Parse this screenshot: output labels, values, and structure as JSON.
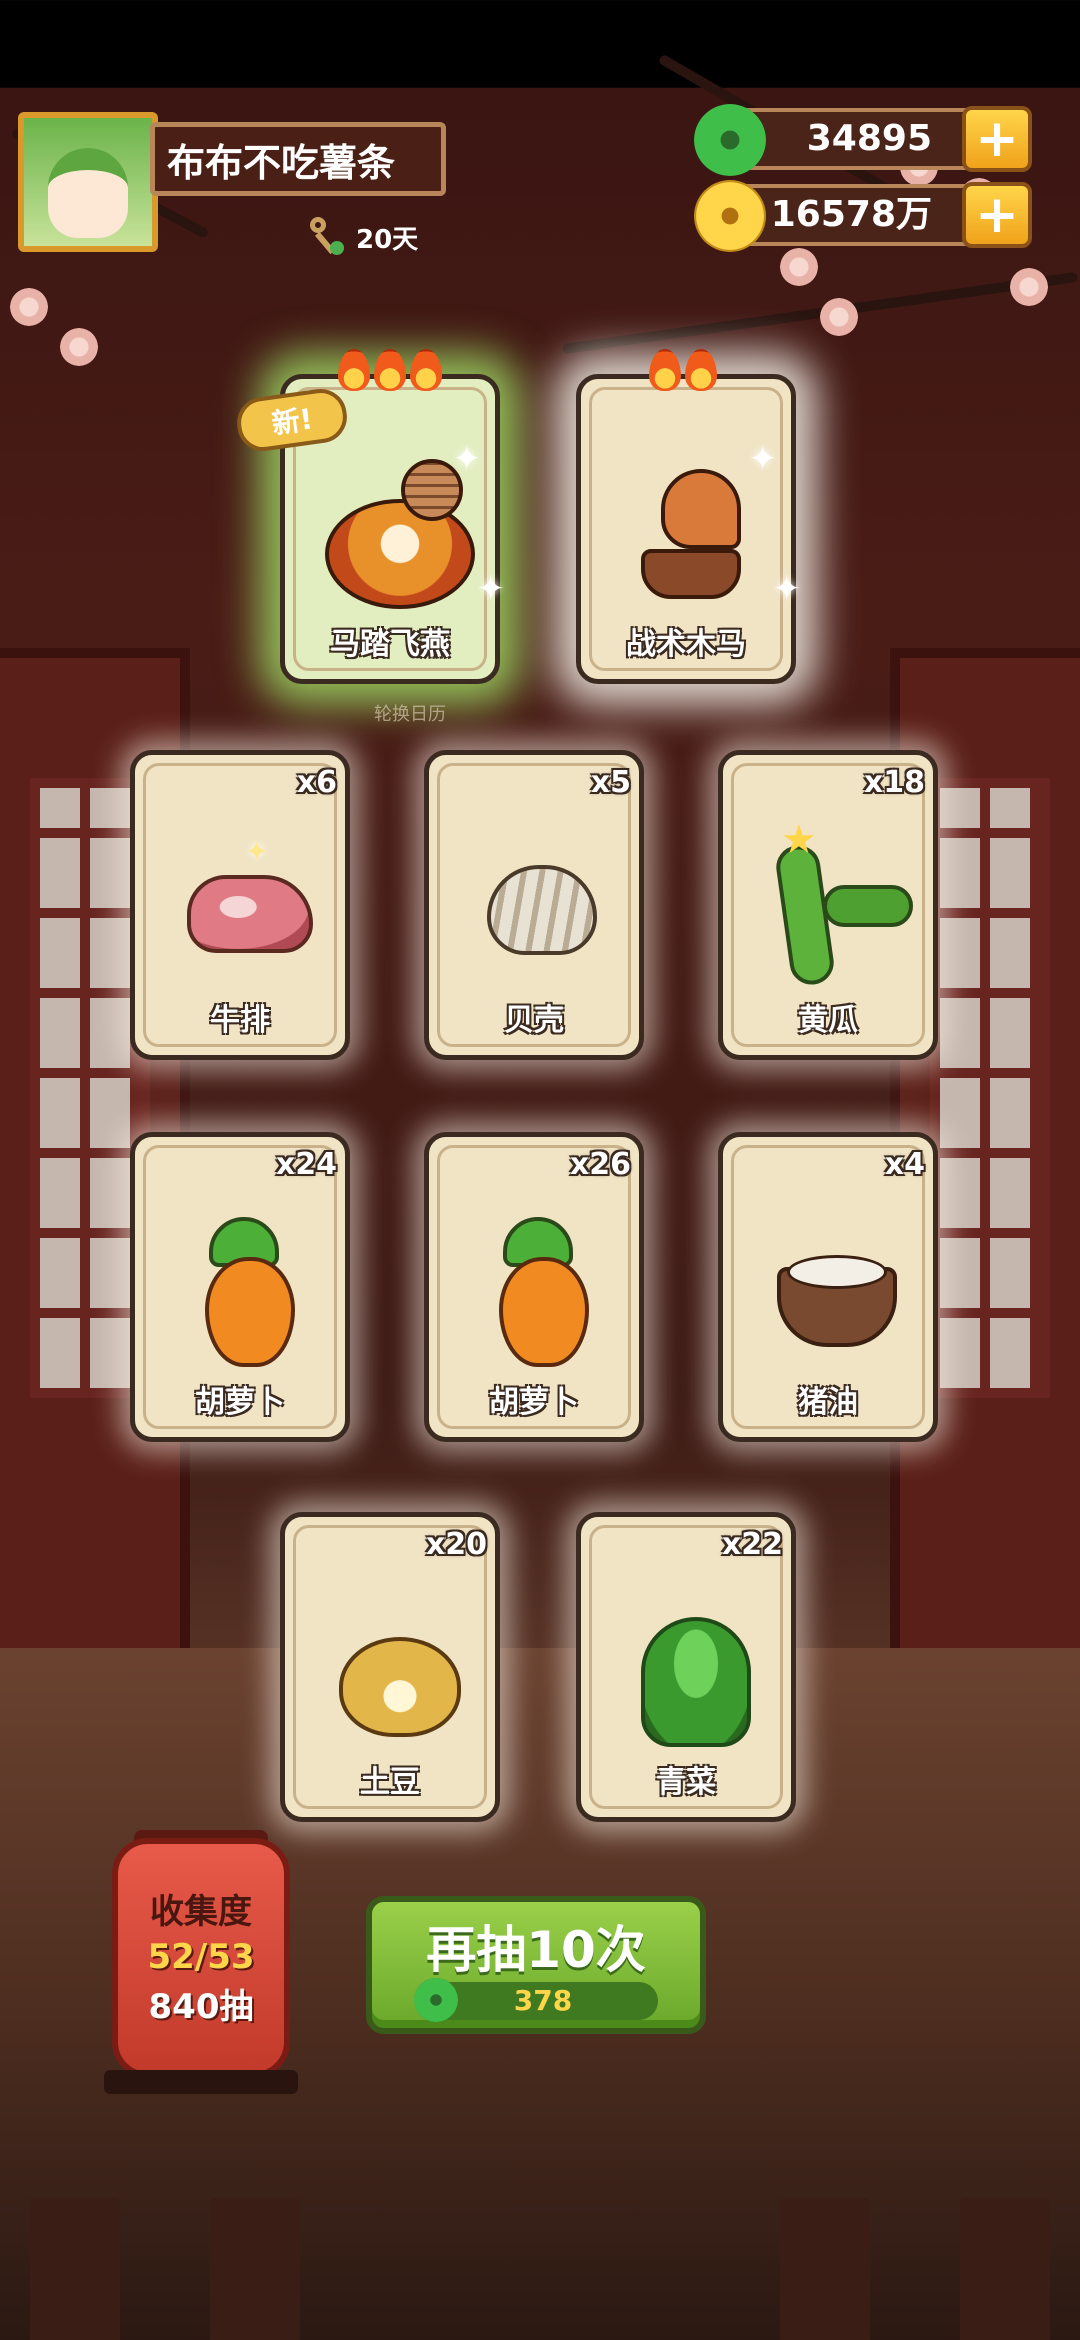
{
  "player": {
    "name": "布布不吃薯条",
    "streak": "20天"
  },
  "currencies": {
    "jade": "34895",
    "gold": "16578万"
  },
  "featured_cards": [
    {
      "label": "马踏飞燕",
      "flames": 3,
      "badge": "新!",
      "glow": "#aaf06e"
    },
    {
      "label": "战术木马",
      "flames": 2,
      "glow": "#fffff5"
    }
  ],
  "overlay_text": "轮换日历",
  "cards": [
    {
      "label": "牛排",
      "count": "x6"
    },
    {
      "label": "贝壳",
      "count": "x5"
    },
    {
      "label": "黄瓜",
      "count": "x18"
    },
    {
      "label": "胡萝卜",
      "count": "x24"
    },
    {
      "label": "胡萝卜",
      "count": "x26"
    },
    {
      "label": "猪油",
      "count": "x4"
    },
    {
      "label": "土豆",
      "count": "x20"
    },
    {
      "label": "青菜",
      "count": "x22"
    }
  ],
  "collection": {
    "title": "收集度",
    "progress": "52/53",
    "draws": "840抽"
  },
  "draw_button": {
    "label": "再抽10次",
    "cost": "378"
  },
  "colors": {
    "accent_green": "#6aa82a",
    "gold_plus": "#ffd54a",
    "lantern_red": "#e85a4a"
  }
}
